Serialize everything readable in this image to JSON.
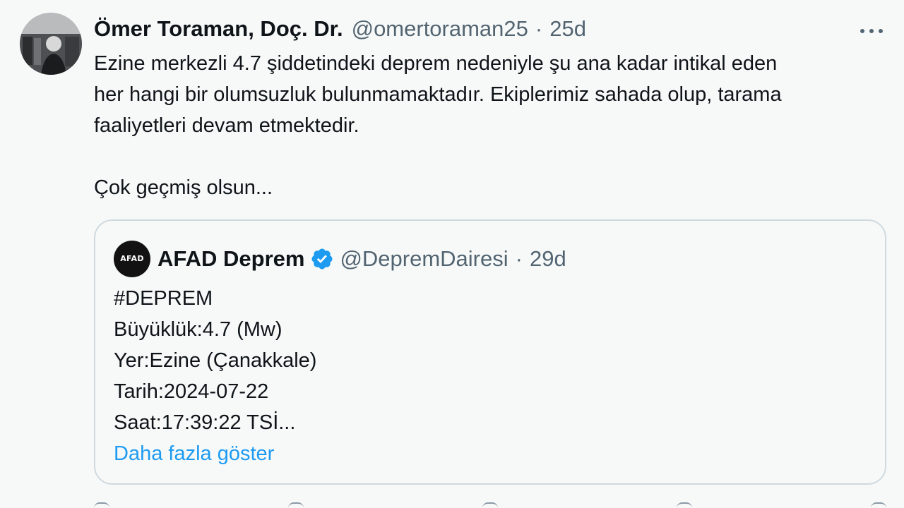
{
  "tweet": {
    "author_name": "Ömer Toraman, Doç. Dr.",
    "author_handle": "@omertoraman25",
    "separator": "·",
    "time_ago": "25d",
    "body_lines": [
      "Ezine merkezli 4.7 şiddetindeki deprem nedeniyle şu ana kadar intikal eden",
      "her hangi bir olumsuzluk bulunmamaktadır. Ekiplerimiz sahada olup, tarama",
      "faaliyetleri devam etmektedir.",
      "",
      "Çok geçmiş olsun..."
    ]
  },
  "quote": {
    "avatar_text": "AFAD",
    "author_name": "AFAD Deprem",
    "author_handle": "@DepremDairesi",
    "separator": "·",
    "time_ago": "29d",
    "lines": [
      "#DEPREM",
      "Büyüklük:4.7 (Mw)",
      "Yer:Ezine (Çanakkale)",
      "Tarih:2024-07-22",
      "Saat:17:39:22 TSİ..."
    ],
    "show_more": "Daha fazla göster"
  },
  "colors": {
    "background": "#f7f9f9",
    "text": "#0f1419",
    "secondary": "#536471",
    "link": "#1d9bf0",
    "verified": "#1d9bf0",
    "border": "#cfd9de"
  },
  "icons": {
    "more": "more-horizontal-icon",
    "verified": "verified-badge-icon"
  }
}
